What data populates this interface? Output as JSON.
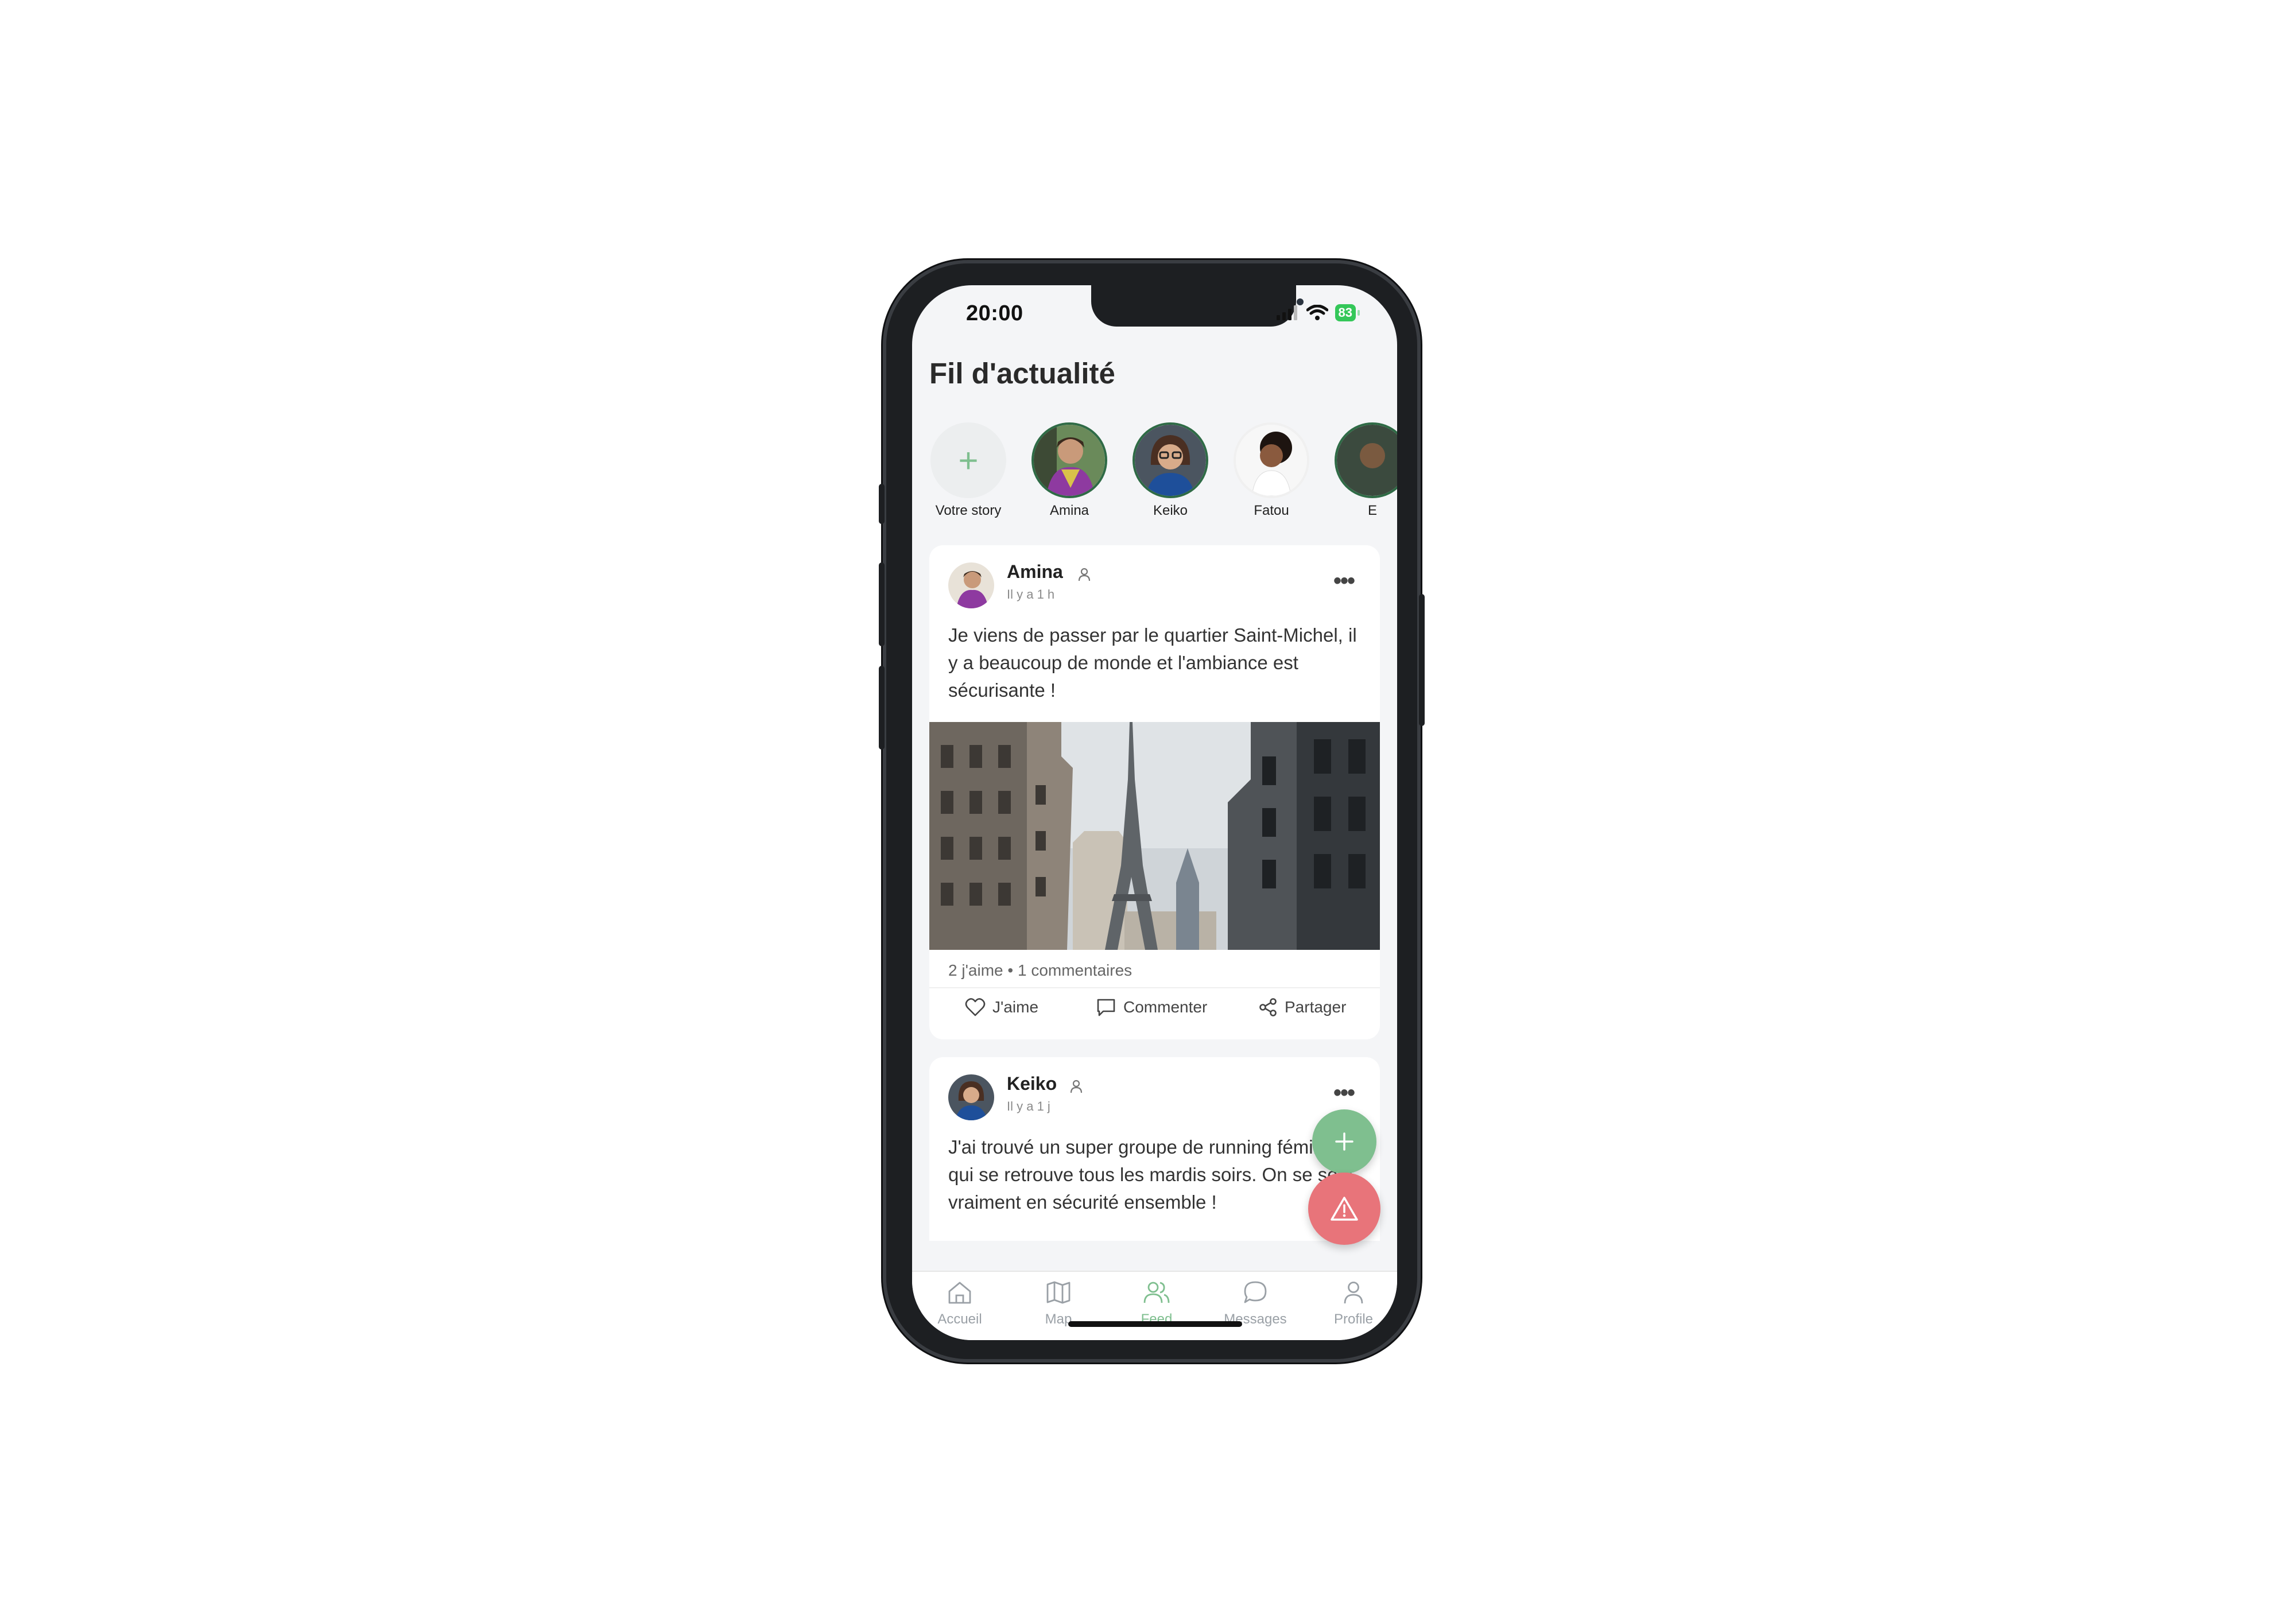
{
  "status_bar": {
    "time": "20:00",
    "battery": "83"
  },
  "page_title": "Fil d'actualité",
  "stories": [
    {
      "label": "Votre story",
      "type": "add"
    },
    {
      "label": "Amina",
      "type": "user"
    },
    {
      "label": "Keiko",
      "type": "user"
    },
    {
      "label": "Fatou",
      "type": "user"
    },
    {
      "label": "E",
      "type": "user"
    }
  ],
  "posts": [
    {
      "author": "Amina",
      "time": "Il y a 1 h",
      "text": "Je viens de passer par le quartier Saint-Michel, il y a beaucoup de monde et l'ambiance est sécurisante !",
      "stats": "2 j'aime • 1 commentaires",
      "actions": {
        "like": "J'aime",
        "comment": "Commenter",
        "share": "Partager"
      }
    },
    {
      "author": "Keiko",
      "time": "Il y a 1 j",
      "text": "J'ai trouvé un super groupe de running féminin qui se retrouve tous les mardis soirs. On se sent vraiment en sécurité ensemble !"
    }
  ],
  "fabs": {
    "add": "plus-icon",
    "alert": "warning-icon"
  },
  "tabs": [
    {
      "label": "Accueil",
      "icon": "home-icon",
      "active": false
    },
    {
      "label": "Map",
      "icon": "map-icon",
      "active": false
    },
    {
      "label": "Feed",
      "icon": "users-icon",
      "active": true
    },
    {
      "label": "Messages",
      "icon": "chat-icon",
      "active": false
    },
    {
      "label": "Profile",
      "icon": "user-icon",
      "active": false
    }
  ],
  "colors": {
    "accent": "#7fbf8f",
    "alert": "#e8747a",
    "story_ring": "#2f6b46"
  }
}
